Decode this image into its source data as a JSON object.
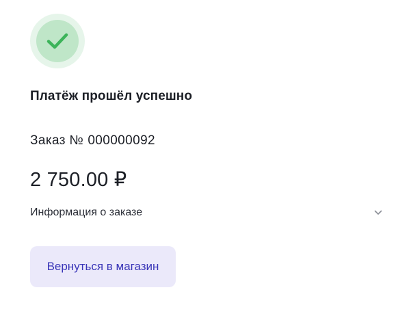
{
  "status": {
    "icon": "check-circle-icon",
    "title": "Платёж прошёл успешно",
    "colors": {
      "outer_ring": "#e6f5ea",
      "inner_circle": "#bfe6c8",
      "check": "#3cb45a"
    }
  },
  "order": {
    "label": "Заказ №",
    "number": "000000092",
    "amount": "2 750.00 ₽"
  },
  "order_info": {
    "label": "Информация о заказе",
    "icon": "chevron-down-icon",
    "expanded": false
  },
  "actions": {
    "back_label": "Вернуться в магазин",
    "colors": {
      "background": "#ebe9fa",
      "text": "#3a36b8"
    }
  }
}
